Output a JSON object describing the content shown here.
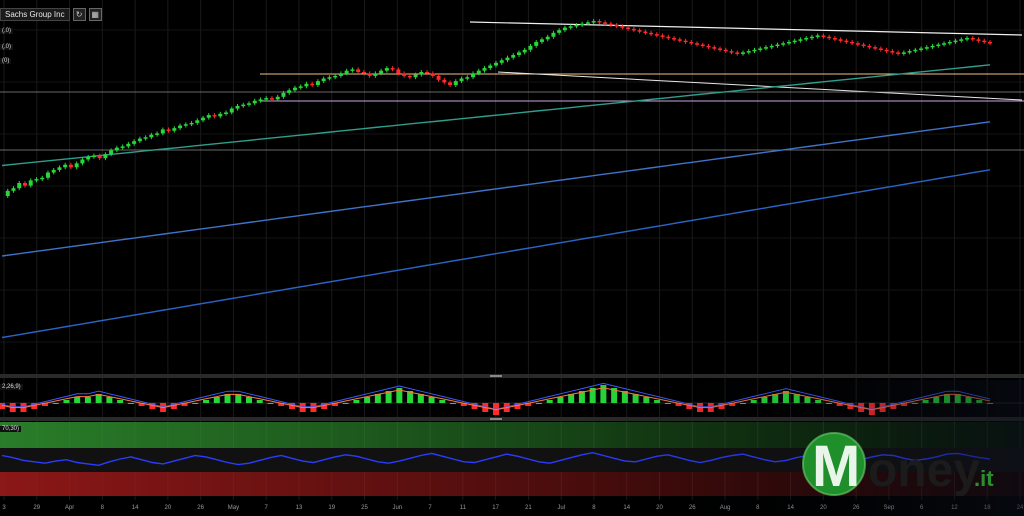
{
  "header": {
    "symbol": "Sachs Group Inc"
  },
  "indicator_labels": {
    "ma1": "(,0)",
    "ma2": "(,0)",
    "ma3": "(0)",
    "macd": "2,26,9)",
    "rsi": "70,30)"
  },
  "x_axis_labels": [
    "3",
    "29",
    "Apr",
    "8",
    "14",
    "20",
    "26",
    "May",
    "7",
    "13",
    "19",
    "25",
    "Jun",
    "7",
    "11",
    "17",
    "21",
    "Jul",
    "8",
    "14",
    "20",
    "26",
    "Aug",
    "8",
    "14",
    "20",
    "26",
    "Sep",
    "6",
    "12",
    "18",
    "24"
  ],
  "logo": {
    "word": "oney",
    "suffix": ".it",
    "letter": "M"
  },
  "colors": {
    "bull": "#27d83a",
    "bear": "#ff2a2a",
    "ma_fast": "#2f9d8b",
    "ma_mid": "#3f72c8",
    "ma_slow": "#2a63c4",
    "resistance": "#f0f0f0",
    "pivot": "#f0c080",
    "support": "#c9a6e6",
    "rsi_line": "#2a3cff",
    "rsi_top_zone": "#2e8b2e",
    "rsi_bottom_zone": "#9b1a1a",
    "logo_green": "#1e8f2a"
  },
  "chart_data": [
    {
      "type": "candlestick",
      "name": "price",
      "close": [
        66,
        70,
        72,
        76,
        74,
        78,
        79,
        80,
        84,
        86,
        88,
        90,
        88,
        91,
        94,
        96,
        97,
        95,
        98,
        101,
        103,
        104,
        106,
        108,
        110,
        111,
        113,
        114,
        117,
        116,
        118,
        120,
        121,
        122,
        124,
        126,
        128,
        127,
        129,
        130,
        133,
        135,
        136,
        137,
        139,
        140,
        141,
        140,
        142,
        145,
        147,
        149,
        150,
        152,
        151,
        154,
        156,
        157,
        158,
        160,
        162,
        163,
        161,
        160,
        158,
        160,
        162,
        164,
        163,
        160,
        158,
        157,
        159,
        161,
        160,
        158,
        155,
        153,
        151,
        154,
        156,
        157,
        160,
        162,
        164,
        166,
        168,
        170,
        172,
        174,
        176,
        178,
        181,
        184,
        186,
        188,
        191,
        193,
        195,
        196,
        197,
        198,
        199,
        200,
        199,
        198,
        197,
        196,
        195,
        194,
        193,
        192,
        191,
        190,
        189,
        188,
        187,
        186,
        185,
        184,
        183,
        182,
        181,
        180,
        179,
        178,
        177,
        176,
        175,
        176,
        177,
        178,
        179,
        180,
        181,
        182,
        183,
        184,
        185,
        186,
        187,
        188,
        189,
        188,
        187,
        186,
        185,
        184,
        183,
        182,
        181,
        180,
        179,
        178,
        177,
        176,
        175,
        176,
        177,
        178,
        179,
        180,
        181,
        182,
        183,
        184,
        185,
        186,
        187,
        186,
        185,
        184,
        183
      ],
      "ma_fast": [
        60,
        62,
        64,
        66,
        68,
        70,
        72,
        74,
        76,
        78,
        80,
        82,
        84,
        86,
        88,
        90,
        92,
        94,
        96,
        98,
        100,
        102,
        104,
        106,
        108,
        110,
        112,
        114,
        116,
        118,
        120,
        122,
        124,
        126,
        128,
        130,
        132,
        134,
        136,
        138,
        140,
        142,
        144,
        146,
        148,
        150,
        152,
        154,
        156,
        158,
        160,
        162,
        164,
        166,
        168,
        170,
        172,
        174,
        176,
        178,
        180,
        182
      ],
      "ma_mid": [
        40,
        42,
        44,
        46,
        48,
        50,
        52,
        54,
        56,
        58,
        60,
        62,
        64,
        66,
        68,
        70,
        72,
        74,
        76,
        78,
        80,
        82,
        84,
        86,
        88,
        90,
        92,
        94,
        96,
        98,
        100,
        102,
        104,
        106,
        108,
        110,
        112,
        114,
        116,
        118,
        120,
        122,
        124,
        126,
        128,
        130,
        132,
        134,
        136,
        138,
        140,
        142,
        144,
        146,
        148,
        150,
        152,
        154,
        156,
        158,
        160,
        162
      ],
      "ma_slow": [
        20,
        22,
        24,
        26,
        28,
        30,
        32,
        34,
        36,
        38,
        40,
        42,
        44,
        46,
        48,
        50,
        52,
        54,
        56,
        58,
        60,
        62,
        64,
        66,
        68,
        70,
        72,
        74,
        76,
        78,
        80,
        82,
        84,
        86,
        88,
        90,
        92,
        94,
        96,
        98,
        100,
        102,
        104,
        106,
        108,
        110,
        112,
        114,
        116,
        118,
        120,
        122,
        124,
        126,
        128,
        130,
        132,
        134,
        136,
        138,
        140,
        142
      ],
      "x_axis_labels_ref": "x_axis_labels"
    },
    {
      "type": "macd_histogram",
      "values": [
        -2,
        -3,
        -3,
        -2,
        -1,
        0,
        1,
        2,
        2,
        3,
        2,
        1,
        0,
        -1,
        -2,
        -3,
        -2,
        -1,
        0,
        1,
        2,
        3,
        3,
        2,
        1,
        0,
        -1,
        -2,
        -3,
        -3,
        -2,
        -1,
        0,
        1,
        2,
        3,
        4,
        5,
        4,
        3,
        2,
        1,
        0,
        -1,
        -2,
        -3,
        -4,
        -3,
        -2,
        -1,
        0,
        1,
        2,
        3,
        4,
        5,
        6,
        5,
        4,
        3,
        2,
        1,
        0,
        -1,
        -2,
        -3,
        -3,
        -2,
        -1,
        0,
        1,
        2,
        3,
        4,
        3,
        2,
        1,
        0,
        -1,
        -2,
        -3,
        -4,
        -3,
        -2,
        -1,
        0,
        1,
        2,
        3,
        3,
        2,
        1,
        0
      ]
    },
    {
      "type": "rsi",
      "values": [
        55,
        52,
        48,
        46,
        44,
        47,
        49,
        45,
        43,
        41,
        46,
        50,
        53,
        49,
        45,
        43,
        47,
        51,
        55,
        53,
        49,
        45,
        42,
        44,
        48,
        52,
        55,
        51,
        47,
        45,
        49,
        53,
        56,
        54,
        50,
        46,
        44,
        47,
        51,
        55,
        58,
        54,
        50,
        46,
        45,
        49,
        53,
        57,
        54,
        50,
        46,
        44,
        48,
        52,
        56,
        59,
        55,
        51,
        47,
        46,
        50,
        54,
        56,
        52,
        48,
        45,
        48,
        52,
        55,
        57,
        53,
        49,
        46,
        48,
        52,
        55,
        58,
        54,
        50,
        47,
        49,
        53,
        56,
        55,
        51,
        48,
        50,
        53,
        57,
        58,
        55,
        52,
        50
      ]
    }
  ]
}
